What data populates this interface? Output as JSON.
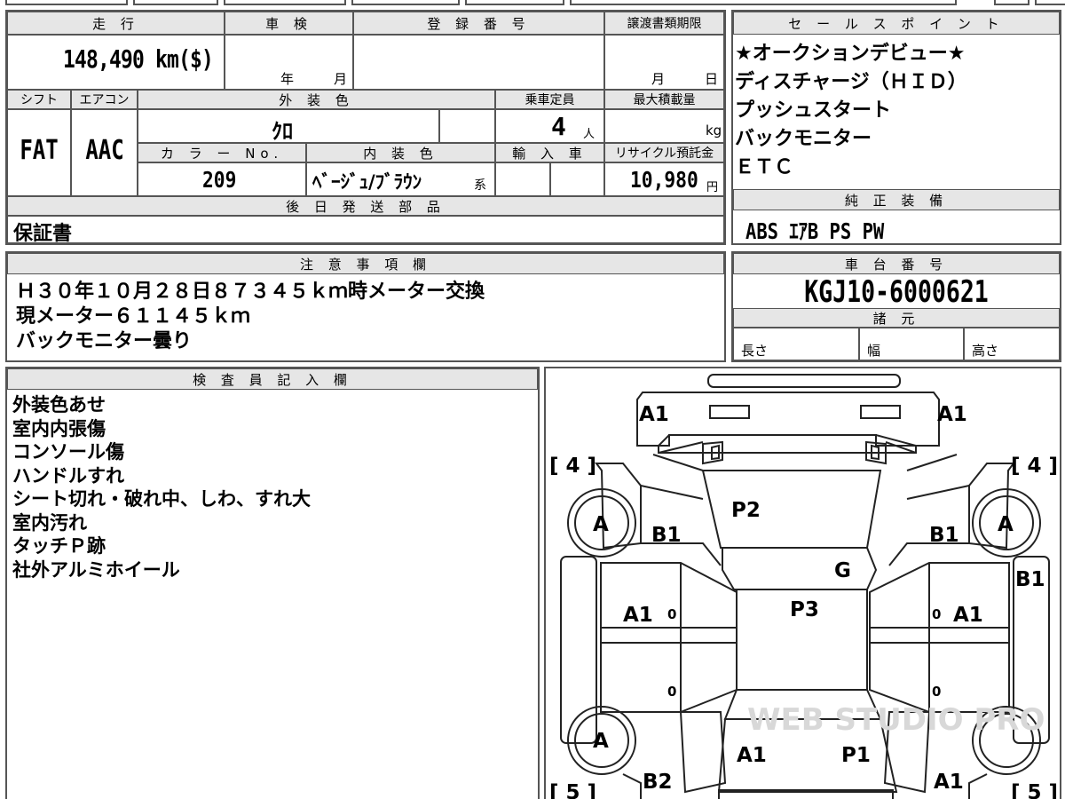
{
  "vehicle_info": {
    "mileage_label": "走 行",
    "mileage": "148,490 km($)",
    "inspection_label": "車 検",
    "inspection_year": "年",
    "inspection_month": "月",
    "registration_label": "登 録 番 号",
    "transfer_deadline_label": "譲渡書類期限",
    "transfer_month": "月",
    "transfer_day": "日",
    "shift_label": "シフト",
    "shift": "FAT",
    "aircon_label": "エアコン",
    "aircon": "AAC",
    "exterior_color_label": "外 装 色",
    "exterior_color": "ｸﾛ",
    "capacity_label": "乗車定員",
    "capacity": "4",
    "capacity_unit": "人",
    "max_load_label": "最大積載量",
    "max_load_unit": "kg",
    "color_no_label": "カ ラ ー No.",
    "color_no": "209",
    "interior_color_label": "内 装 色",
    "interior_color": "ﾍﾞｰｼﾞｭ/ﾌﾞﾗｳﾝ",
    "interior_color_suffix": "系",
    "import_label": "輸 入 車",
    "recycle_label": "リサイクル預託金",
    "recycle_fee": "10,980",
    "recycle_unit": "円",
    "later_parts_label": "後 日 発 送 部 品",
    "later_parts": "保証書"
  },
  "sales_points": {
    "label": "セ ー ル ス ポ イ ン ト",
    "items": [
      "★オークションデビュー★",
      "ディスチャージ（ＨＩＤ）",
      "プッシュスタート",
      "バックモニター",
      "ＥＴＣ"
    ]
  },
  "genuine_equipment": {
    "label": "純 正 装 備",
    "value": "ABS ｴｱB PS PW"
  },
  "notes": {
    "label": "注 意 事 項 欄",
    "lines": [
      "Ｈ３０年１０月２８日８７３４５ｋｍ時メーター交換",
      "現メーター６１１４５ｋｍ",
      "バックモニター曇り"
    ]
  },
  "chassis": {
    "label": "車 台 番 号",
    "value": "KGJ10-6000621",
    "specs_label": "諸 元",
    "length_label": "長さ",
    "width_label": "幅",
    "height_label": "高さ"
  },
  "inspector": {
    "label": "検 査 員 記 入 欄",
    "lines": [
      "外装色あせ",
      "室内内張傷",
      "コンソール傷",
      "ハンドルすれ",
      "シート切れ・破れ中、しわ、すれ大",
      "室内汚れ",
      "タッチＰ跡",
      "社外アルミホイール"
    ]
  },
  "diagram": {
    "marks": {
      "front_left": "A1",
      "front_right": "A1",
      "bracket_top_left": "[ 4 ]",
      "bracket_top_right": "[ 4 ]",
      "wheel_fl": "A",
      "wheel_fr": "A",
      "wheel_rl": "A",
      "fender_fl": "B1",
      "fender_fr": "B1",
      "hood": "P2",
      "windshield": "G",
      "right_side": "B1",
      "door_fl": "A1",
      "door_fr": "A1",
      "roof": "P3",
      "door_mark_fl": "0",
      "door_mark_fr": "0",
      "door_mark_rl": "0",
      "door_mark_rr": "0",
      "trunk_left": "A1",
      "trunk_right": "P1",
      "rear_left": "B2",
      "rear_right": "A1",
      "bracket_bottom_left": "[ 5 ]",
      "bracket_bottom_right": "[ 5 ]"
    },
    "watermark": "WEB STUDIO PRO"
  }
}
